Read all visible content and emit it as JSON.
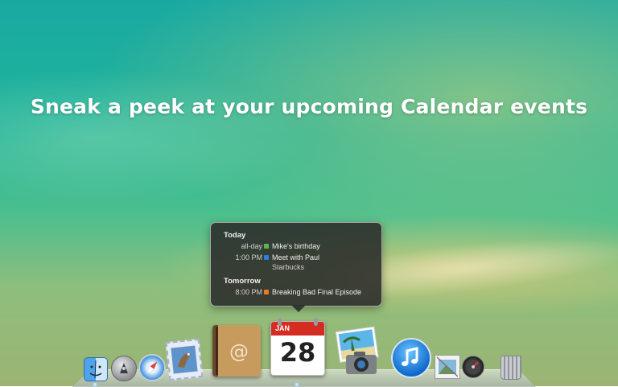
{
  "headline": "Sneak a peek at your upcoming Calendar events",
  "calendar_peek": {
    "sections": [
      {
        "title": "Today",
        "events": [
          {
            "time": "all-day",
            "title": "Mike's birthday",
            "color": "#58b64b"
          },
          {
            "time": "1:00 PM",
            "title": "Meet with Paul",
            "subtitle": "Starbucks",
            "color": "#2f7fe0"
          }
        ]
      },
      {
        "title": "Tomorrow",
        "events": [
          {
            "time": "8:00 PM",
            "title": "Breaking Bad Final Episode",
            "color": "#f07a1e"
          }
        ]
      }
    ]
  },
  "dock": {
    "calendar_icon": {
      "month": "JAN",
      "day": "28"
    },
    "items": [
      {
        "icon": "finder-icon"
      },
      {
        "icon": "launchpad-icon"
      },
      {
        "icon": "safari-icon"
      },
      {
        "icon": "mail-icon"
      },
      {
        "icon": "address-book-icon"
      },
      {
        "icon": "calendar-icon"
      },
      {
        "icon": "iphoto-icon"
      },
      {
        "icon": "itunes-icon"
      },
      {
        "icon": "preview-icon"
      },
      {
        "icon": "dashboard-icon"
      },
      {
        "icon": "trash-icon"
      }
    ]
  }
}
